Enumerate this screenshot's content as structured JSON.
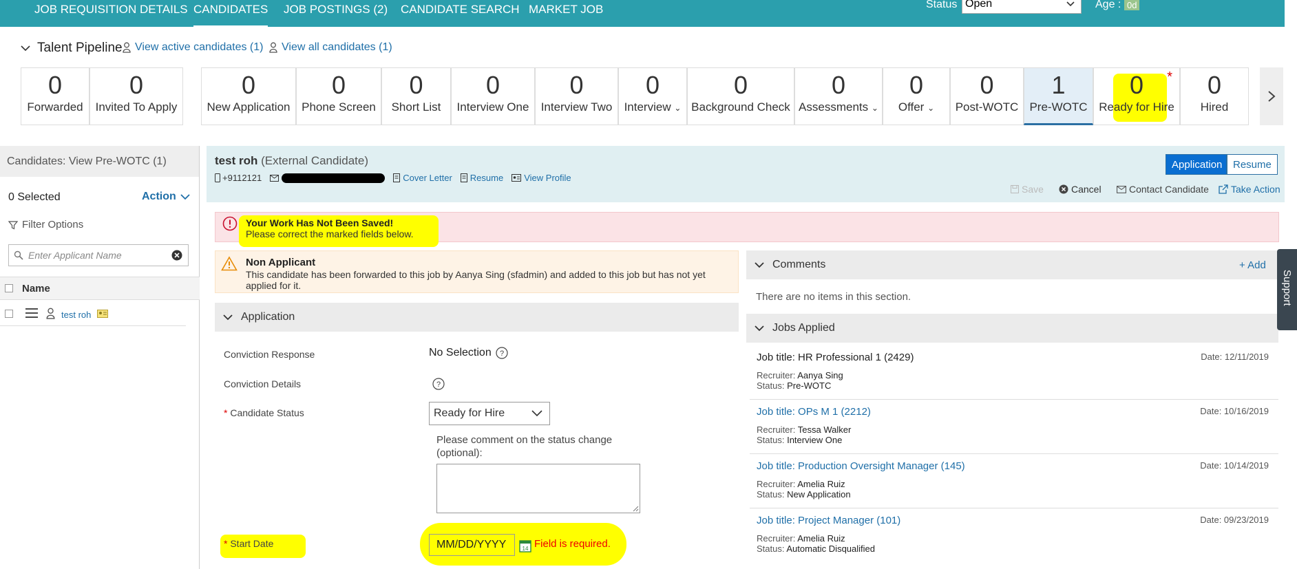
{
  "nav": {
    "tabs": [
      {
        "label": "JOB REQUISITION DETAILS"
      },
      {
        "label": "CANDIDATES"
      },
      {
        "label": "JOB POSTINGS (2)"
      },
      {
        "label": "CANDIDATE SEARCH"
      },
      {
        "label": "MARKET JOB"
      }
    ],
    "active_index": 1,
    "status_label": "Status",
    "status_value": "Open",
    "age_label": "Age :",
    "age_value": "0d"
  },
  "pipeline": {
    "title": "Talent Pipeline",
    "view_active": "View active candidates (1)",
    "view_all": "View all candidates (1)",
    "stages": [
      {
        "count": "0",
        "label": "Forwarded"
      },
      {
        "count": "0",
        "label": "Invited To Apply"
      },
      {
        "count": "0",
        "label": "New Application"
      },
      {
        "count": "0",
        "label": "Phone Screen"
      },
      {
        "count": "0",
        "label": "Short List"
      },
      {
        "count": "0",
        "label": "Interview One"
      },
      {
        "count": "0",
        "label": "Interview Two"
      },
      {
        "count": "0",
        "label": "Interview"
      },
      {
        "count": "0",
        "label": "Background Check"
      },
      {
        "count": "0",
        "label": "Assessments"
      },
      {
        "count": "0",
        "label": "Offer"
      },
      {
        "count": "0",
        "label": "Post-WOTC"
      },
      {
        "count": "1",
        "label": "Pre-WOTC"
      },
      {
        "count": "0",
        "label": "Ready for Hire"
      },
      {
        "count": "0",
        "label": "Hired"
      }
    ],
    "selected_stage": "Pre-WOTC"
  },
  "left": {
    "header": "Candidates: View Pre-WOTC (1)",
    "selected": "0 Selected",
    "action": "Action",
    "filter": "Filter Options",
    "search_placeholder": "Enter Applicant Name",
    "name_col": "Name",
    "candidate": "test roh"
  },
  "candidate": {
    "name": "test roh",
    "type": "(External Candidate)",
    "phone": "+9112121",
    "cover_letter": "Cover Letter",
    "resume": "Resume",
    "view_profile": "View Profile",
    "tab_application": "Application",
    "tab_resume": "Resume",
    "save": "Save",
    "cancel": "Cancel",
    "contact": "Contact Candidate",
    "take_action": "Take Action"
  },
  "alerts": {
    "error_title": "Your Work Has Not Been Saved!",
    "error_sub": "Please correct the marked fields below.",
    "warn_title": "Non Applicant",
    "warn_text": "This candidate has been forwarded to this job by Aanya Sing (sfadmin) and added to this job but has not yet applied for it."
  },
  "application": {
    "section": "Application",
    "conviction_response_label": "Conviction Response",
    "conviction_response_value": "No Selection",
    "conviction_details_label": "Conviction Details",
    "candidate_status_label": "Candidate Status",
    "candidate_status_value": "Ready for Hire",
    "comment_label": "Please comment on the status change (optional):",
    "start_date_label": "Start Date",
    "start_date_value": "MM/DD/YYYY",
    "calendar_day": "14",
    "required_msg": "Field is required.",
    "required_marker": "*"
  },
  "comments": {
    "section": "Comments",
    "add": "+ Add",
    "empty": "There are no items in this section."
  },
  "jobs": {
    "section": "Jobs Applied",
    "recruiter_label": "Recruiter:",
    "status_label": "Status:",
    "items": [
      {
        "title": "Job title: HR Professional 1 (2429)",
        "date": "Date: 12/11/2019",
        "recruiter": "Aanya Sing",
        "status": "Pre-WOTC"
      },
      {
        "title": "Job title: OPs M 1 (2212)",
        "date": "Date: 10/16/2019",
        "recruiter": "Tessa Walker",
        "status": "Interview One"
      },
      {
        "title": "Job title: Production Oversight Manager (145)",
        "date": "Date: 10/14/2019",
        "recruiter": "Amelia Ruiz",
        "status": "New Application"
      },
      {
        "title": "Job title: Project Manager (101)",
        "date": "Date: 09/23/2019",
        "recruiter": "Amelia Ruiz",
        "status": "Automatic Disqualified"
      }
    ]
  },
  "support": "Support"
}
